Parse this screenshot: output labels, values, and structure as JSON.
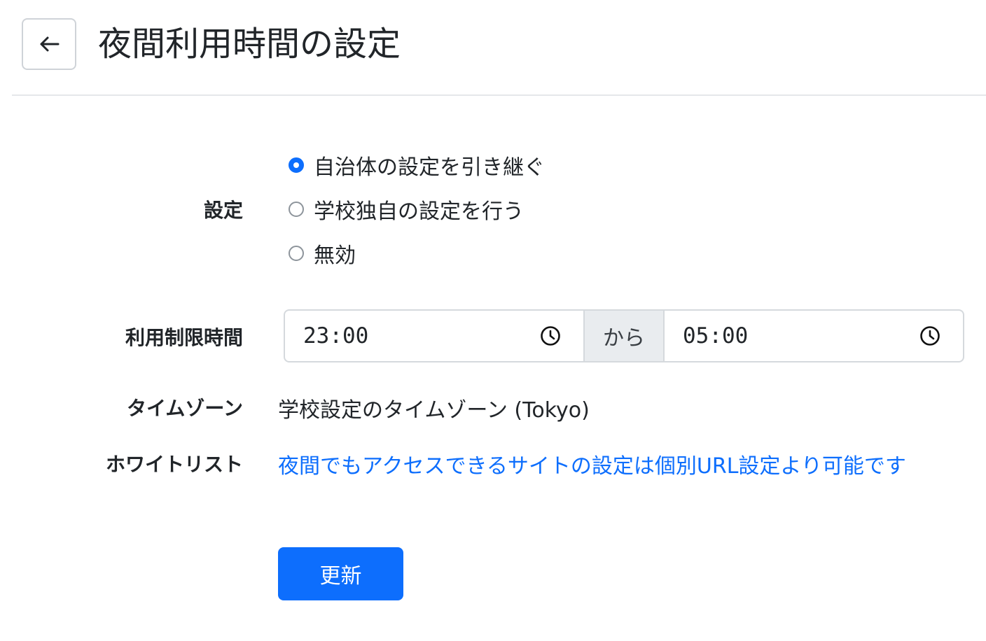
{
  "header": {
    "title": "夜間利用時間の設定",
    "back_icon": "arrow-left-icon"
  },
  "form": {
    "setting": {
      "label": "設定",
      "options": [
        {
          "label": "自治体の設定を引き継ぐ",
          "checked": true
        },
        {
          "label": "学校独自の設定を行う",
          "checked": false
        },
        {
          "label": "無効",
          "checked": false
        }
      ]
    },
    "restriction": {
      "label": "利用制限時間",
      "start": "23:00",
      "separator": "から",
      "end": "05:00",
      "clock_icon": "clock-icon"
    },
    "timezone": {
      "label": "タイムゾーン",
      "value": "学校設定のタイムゾーン (Tokyo)"
    },
    "whitelist": {
      "label": "ホワイトリスト",
      "link_text": "夜間でもアクセスできるサイトの設定は個別URL設定より可能です"
    },
    "submit_label": "更新"
  },
  "colors": {
    "primary": "#0d6efd",
    "addon_bg": "#e9ecef",
    "border": "#d5d9dd"
  }
}
